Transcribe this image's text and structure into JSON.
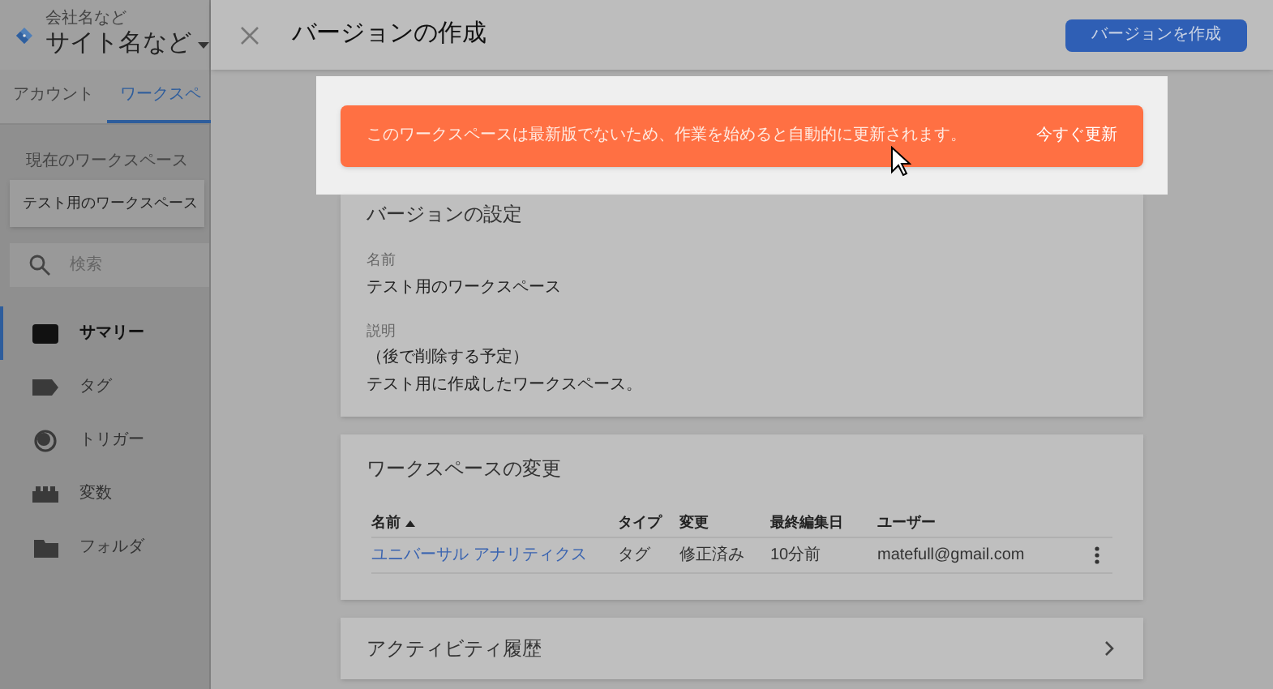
{
  "sidebar": {
    "account": {
      "company": "会社名など",
      "site": "サイト名など"
    },
    "tabs": [
      {
        "label": "アカウント",
        "selected": false
      },
      {
        "label": "ワークスペ",
        "selected": true
      }
    ],
    "current_workspace": {
      "label": "現在のワークスペース",
      "value": "テスト用のワークスペース"
    },
    "search": {
      "placeholder": "検索"
    },
    "items": [
      {
        "label": "サマリー",
        "selected": true
      },
      {
        "label": "タグ",
        "selected": false
      },
      {
        "label": "トリガー",
        "selected": false
      },
      {
        "label": "変数",
        "selected": false
      },
      {
        "label": "フォルダ",
        "selected": false
      }
    ]
  },
  "dialog": {
    "title": "バージョンの作成",
    "create_button": "バージョンを作成",
    "banner": {
      "message": "このワークスペースは最新版でないため、作業を始めると自動的に更新されます。",
      "action": "今すぐ更新"
    },
    "version_settings": {
      "title": "バージョンの設定",
      "fields": [
        {
          "label": "名前",
          "lines": [
            "テスト用のワークスペース"
          ]
        },
        {
          "label": "説明",
          "lines": [
            "（後で削除する予定）",
            "テスト用に作成したワークスペース。"
          ]
        }
      ]
    },
    "changes": {
      "title": "ワークスペースの変更",
      "columns": [
        {
          "label": "名前",
          "sorted": true
        },
        {
          "label": "タイプ",
          "sorted": false
        },
        {
          "label": "変更",
          "sorted": false
        },
        {
          "label": "最終編集日",
          "sorted": false
        },
        {
          "label": "ユーザー",
          "sorted": false
        }
      ],
      "rows": [
        {
          "cells": [
            "ユニバーサル アナリティクス",
            "タグ",
            "修正済み",
            "10分前",
            "matefull@gmail.com"
          ]
        }
      ]
    },
    "activity": {
      "title": "アクティビティ履歴"
    }
  }
}
